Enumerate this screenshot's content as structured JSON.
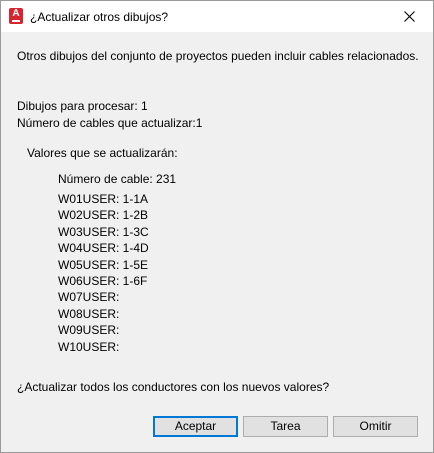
{
  "window": {
    "title": "¿Actualizar otros dibujos?",
    "icon": "autocad-app-icon",
    "icon_letter": "A",
    "accent_color": "#d8242f"
  },
  "message": "Otros dibujos del conjunto de proyectos pueden incluir cables relacionados.",
  "summary": {
    "drawings_label": "Dibujos para procesar: 1",
    "cables_label": "Número de cables que actualizar:1"
  },
  "values_heading": "Valores que se actualizarán:",
  "cable_number": "Número de cable: 231",
  "wires": [
    "W01USER: 1-1A",
    "W02USER: 1-2B",
    "W03USER: 1-3C",
    "W04USER: 1-4D",
    "W05USER: 1-5E",
    "W06USER: 1-6F",
    "W07USER:",
    "W08USER:",
    "W09USER:",
    "W10USER:"
  ],
  "question": "¿Actualizar todos los conductores con los nuevos valores?",
  "buttons": {
    "accept": "Aceptar",
    "task": "Tarea",
    "skip": "Omitir"
  }
}
